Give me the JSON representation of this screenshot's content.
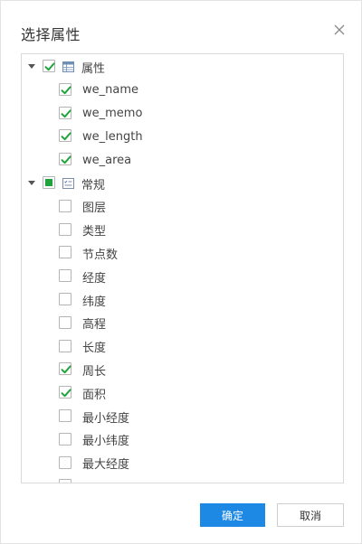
{
  "dialog": {
    "title": "选择属性",
    "ok_label": "确定",
    "cancel_label": "取消"
  },
  "tree": {
    "groups": [
      {
        "label": "属性",
        "icon": "table-icon",
        "state": "checked",
        "expanded": true,
        "children": [
          {
            "label": "we_name",
            "checked": true
          },
          {
            "label": "we_memo",
            "checked": true
          },
          {
            "label": "we_length",
            "checked": true
          },
          {
            "label": "we_area",
            "checked": true
          }
        ]
      },
      {
        "label": "常规",
        "icon": "checklist-icon",
        "state": "partial",
        "expanded": true,
        "children": [
          {
            "label": "图层",
            "checked": false
          },
          {
            "label": "类型",
            "checked": false
          },
          {
            "label": "节点数",
            "checked": false
          },
          {
            "label": "经度",
            "checked": false
          },
          {
            "label": "纬度",
            "checked": false
          },
          {
            "label": "高程",
            "checked": false
          },
          {
            "label": "长度",
            "checked": false
          },
          {
            "label": "周长",
            "checked": true
          },
          {
            "label": "面积",
            "checked": true
          },
          {
            "label": "最小经度",
            "checked": false
          },
          {
            "label": "最小纬度",
            "checked": false
          },
          {
            "label": "最大经度",
            "checked": false
          },
          {
            "label": "",
            "checked": false
          }
        ]
      }
    ]
  },
  "colors": {
    "check_green": "#20a33b",
    "primary_button": "#1e88e5"
  }
}
